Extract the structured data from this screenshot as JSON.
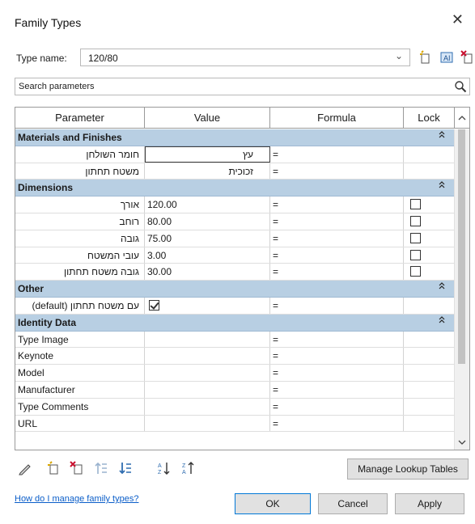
{
  "window": {
    "title": "Family Types"
  },
  "type_name": {
    "label": "Type name:",
    "value": "120/80"
  },
  "search": {
    "placeholder": "Search parameters"
  },
  "table": {
    "headers": [
      "Parameter",
      "Value",
      "Formula",
      "Lock"
    ],
    "rows": [
      {
        "kind": "group",
        "name": "Materials and Finishes"
      },
      {
        "kind": "param",
        "parameter": "חומר השולחן",
        "value": "עץ",
        "value_rtl": true,
        "editing": true,
        "formula": "=",
        "lock": null
      },
      {
        "kind": "param",
        "parameter": "משטח תחתון",
        "value": "זכוכית",
        "value_rtl": true,
        "formula": "=",
        "lock": null
      },
      {
        "kind": "group",
        "name": "Dimensions"
      },
      {
        "kind": "param",
        "parameter": "אורך",
        "value": "120.00",
        "formula": "=",
        "lock": false
      },
      {
        "kind": "param",
        "parameter": "רוחב",
        "value": "80.00",
        "formula": "=",
        "lock": false
      },
      {
        "kind": "param",
        "parameter": "גובה",
        "value": "75.00",
        "formula": "=",
        "lock": false
      },
      {
        "kind": "param",
        "parameter": "עובי המשטח",
        "value": "3.00",
        "formula": "=",
        "lock": false
      },
      {
        "kind": "param",
        "parameter": "גובה משטח תחתון",
        "value": "30.00",
        "formula": "=",
        "lock": false
      },
      {
        "kind": "group",
        "name": "Other"
      },
      {
        "kind": "param",
        "parameter": "עם משטח תחתון (default)",
        "value": "",
        "value_checkbox": true,
        "formula": "=",
        "lock": null
      },
      {
        "kind": "group",
        "name": "Identity Data"
      },
      {
        "kind": "param",
        "parameter": "Type Image",
        "ltr": true,
        "value": "",
        "formula": "=",
        "lock": null
      },
      {
        "kind": "param",
        "parameter": "Keynote",
        "ltr": true,
        "value": "",
        "formula": "=",
        "lock": null
      },
      {
        "kind": "param",
        "parameter": "Model",
        "ltr": true,
        "value": "",
        "formula": "=",
        "lock": null
      },
      {
        "kind": "param",
        "parameter": "Manufacturer",
        "ltr": true,
        "value": "",
        "formula": "=",
        "lock": null
      },
      {
        "kind": "param",
        "parameter": "Type Comments",
        "ltr": true,
        "value": "",
        "formula": "=",
        "lock": null
      },
      {
        "kind": "param",
        "parameter": "URL",
        "ltr": true,
        "value": "",
        "formula": "=",
        "lock": null
      }
    ]
  },
  "toolbar_icons": [
    "edit-pencil-icon",
    "new-parameter-icon",
    "delete-parameter-icon",
    "move-up-icon",
    "move-down-icon",
    "sort-ascending-icon",
    "sort-descending-icon"
  ],
  "buttons": {
    "lookup": "Manage Lookup Tables",
    "ok": "OK",
    "cancel": "Cancel",
    "apply": "Apply"
  },
  "help_link": "How do I manage family types?",
  "colors": {
    "group_header": "#b8cfe3",
    "link": "#0b5ec9",
    "ok_border": "#0078d7"
  }
}
